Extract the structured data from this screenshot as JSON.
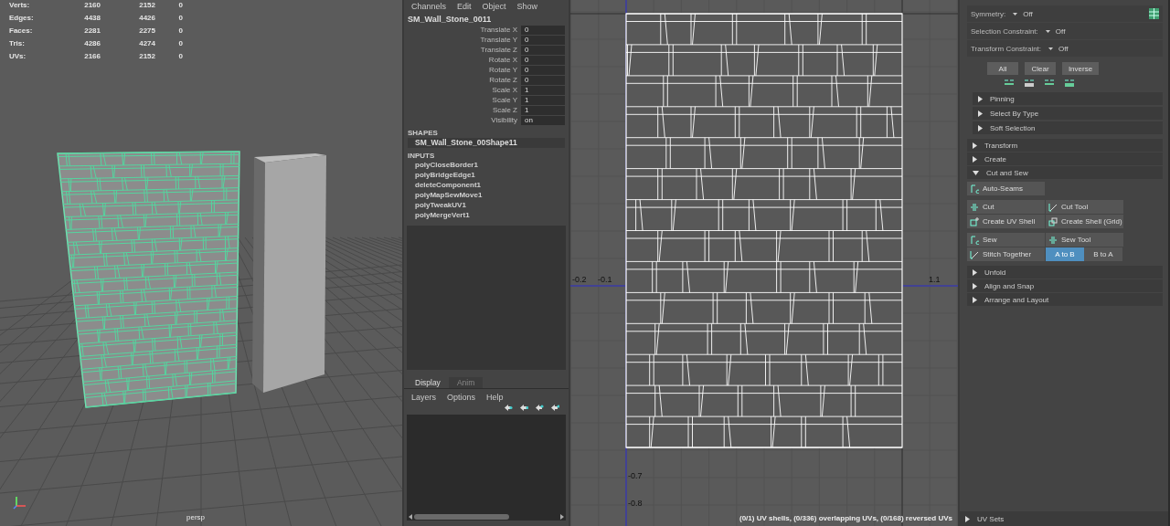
{
  "viewport": {
    "stats": [
      {
        "label": "Verts:",
        "values": [
          "2160",
          "2152",
          "0"
        ]
      },
      {
        "label": "Edges:",
        "values": [
          "4438",
          "4426",
          "0"
        ]
      },
      {
        "label": "Faces:",
        "values": [
          "2281",
          "2275",
          "0"
        ]
      },
      {
        "label": "Tris:",
        "values": [
          "4286",
          "4274",
          "0"
        ]
      },
      {
        "label": "UVs:",
        "values": [
          "2166",
          "2152",
          "0"
        ]
      }
    ],
    "camera_label": "persp"
  },
  "channel_box": {
    "menu": [
      "Channels",
      "Edit",
      "Object",
      "Show"
    ],
    "object_name": "SM_Wall_Stone_0011",
    "channels": [
      {
        "name": "Translate X",
        "value": "0"
      },
      {
        "name": "Translate Y",
        "value": "0"
      },
      {
        "name": "Translate Z",
        "value": "0"
      },
      {
        "name": "Rotate X",
        "value": "0"
      },
      {
        "name": "Rotate Y",
        "value": "0"
      },
      {
        "name": "Rotate Z",
        "value": "0"
      },
      {
        "name": "Scale X",
        "value": "1"
      },
      {
        "name": "Scale Y",
        "value": "1"
      },
      {
        "name": "Scale Z",
        "value": "1"
      },
      {
        "name": "Visibility",
        "value": "on"
      }
    ],
    "shapes_heading": "SHAPES",
    "shape": "SM_Wall_Stone_00Shape11",
    "inputs_heading": "INPUTS",
    "inputs": [
      "polyCloseBorder1",
      "polyBridgeEdge1",
      "deleteComponent1",
      "polyMapSewMove1",
      "polyTweakUV1",
      "polyMergeVert1"
    ]
  },
  "layer_editor": {
    "tabs": [
      {
        "label": "Display",
        "selected": true
      },
      {
        "label": "Anim",
        "selected": false
      }
    ],
    "menu": [
      "Layers",
      "Options",
      "Help"
    ]
  },
  "uv_editor": {
    "u_labels": [
      "-0.2",
      "-0.1",
      "1.1"
    ],
    "v_labels": [
      "-0.7",
      "-0.8"
    ],
    "status": "(0/1) UV shells, (0/336) overlapping UVs, (0/168) reversed UVs"
  },
  "uv_toolkit": {
    "constraints": [
      {
        "label": "Symmetry:",
        "value": "Off"
      },
      {
        "label": "Selection Constraint:",
        "value": "Off"
      },
      {
        "label": "Transform Constraint:",
        "value": "Off"
      }
    ],
    "selection_buttons": [
      "All",
      "Clear",
      "Inverse"
    ],
    "selection_sections": [
      {
        "title": "Pinning",
        "expanded": false
      },
      {
        "title": "Select By Type",
        "expanded": false
      },
      {
        "title": "Soft Selection",
        "expanded": false
      }
    ],
    "sections": [
      {
        "title": "Transform",
        "expanded": false
      },
      {
        "title": "Create",
        "expanded": false
      },
      {
        "title": "Cut and Sew",
        "expanded": true,
        "tool_rows": [
          [
            {
              "label": "Auto-Seams"
            }
          ],
          [
            {
              "label": "Cut"
            },
            {
              "label": "Cut Tool"
            }
          ],
          [
            {
              "label": "Create UV Shell"
            },
            {
              "label": "Create Shell (Grid)"
            }
          ],
          [
            {
              "label": "Sew"
            },
            {
              "label": "Sew Tool"
            }
          ]
        ],
        "stitch": {
          "label": "Stitch Together",
          "directions": [
            {
              "label": "A to B",
              "selected": true
            },
            {
              "label": "B to A",
              "selected": false
            }
          ]
        }
      },
      {
        "title": "Unfold",
        "expanded": false
      },
      {
        "title": "Align and Snap",
        "expanded": false
      },
      {
        "title": "Arrange and Layout",
        "expanded": false
      }
    ],
    "footer_section": {
      "title": "UV Sets",
      "expanded": false
    }
  }
}
